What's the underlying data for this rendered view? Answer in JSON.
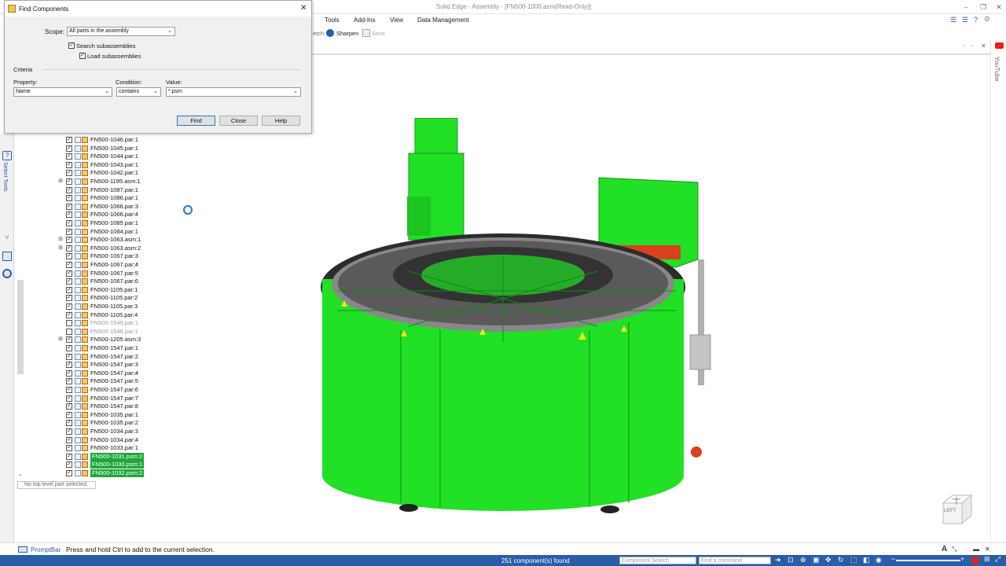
{
  "app": {
    "window_title": "Solid Edge - Assembly - [FN500-1000.asm(Read-Only)]",
    "ribbon_tabs": [
      "Tools",
      "Add-Ins",
      "View",
      "Data Management"
    ],
    "toolbar": {
      "sketch_label": "etch",
      "sharpen_label": "Sharpen",
      "save_label": "Save"
    },
    "youtube_label": "YouTube"
  },
  "dialog": {
    "title": "Find Components",
    "scope_label": "Scope:",
    "scope_value": "All parts in the assembly",
    "search_subassemblies": "Search subassemblies",
    "load_subassemblies": "Load subassemblies",
    "criteria_label": "Criteria",
    "property_label": "Property:",
    "property_value": "Name",
    "condition_label": "Condition:",
    "condition_value": "contains",
    "value_label": "Value:",
    "value_value": "*.psm",
    "find_button": "Find",
    "close_button": "Close",
    "help_button": "Help"
  },
  "left_strip": {
    "select_tools_label": "Select Tools"
  },
  "tree": {
    "items": [
      {
        "label": "FN500-1046.par:1",
        "checked": true,
        "state": "normal",
        "expandable": false
      },
      {
        "label": "FN500-1045.par:1",
        "checked": true,
        "state": "normal",
        "expandable": false
      },
      {
        "label": "FN500-1044.par:1",
        "checked": true,
        "state": "normal",
        "expandable": false
      },
      {
        "label": "FN500-1043.par:1",
        "checked": true,
        "state": "normal",
        "expandable": false
      },
      {
        "label": "FN500-1042.par:1",
        "checked": true,
        "state": "normal",
        "expandable": false
      },
      {
        "label": "FN500-1195.asm:1",
        "checked": true,
        "state": "normal",
        "expandable": true
      },
      {
        "label": "FN500-1087.par:1",
        "checked": true,
        "state": "normal",
        "expandable": false
      },
      {
        "label": "FN500-1086.par:1",
        "checked": true,
        "state": "normal",
        "expandable": false
      },
      {
        "label": "FN500-1066.par:3",
        "checked": true,
        "state": "normal",
        "expandable": false
      },
      {
        "label": "FN500-1066.par:4",
        "checked": true,
        "state": "normal",
        "expandable": false
      },
      {
        "label": "FN500-1085.par:1",
        "checked": true,
        "state": "normal",
        "expandable": false
      },
      {
        "label": "FN500-1084.par:1",
        "checked": true,
        "state": "normal",
        "expandable": false
      },
      {
        "label": "FN500-1063.asm:1",
        "checked": true,
        "state": "normal",
        "expandable": true
      },
      {
        "label": "FN500-1063.asm:2",
        "checked": true,
        "state": "normal",
        "expandable": true
      },
      {
        "label": "FN500-1067.par:3",
        "checked": true,
        "state": "normal",
        "expandable": false
      },
      {
        "label": "FN500-1067.par:4",
        "checked": true,
        "state": "normal",
        "expandable": false
      },
      {
        "label": "FN500-1067.par:5",
        "checked": true,
        "state": "normal",
        "expandable": false
      },
      {
        "label": "FN500-1067.par:6",
        "checked": true,
        "state": "normal",
        "expandable": false
      },
      {
        "label": "FN500-1105.par:1",
        "checked": true,
        "state": "normal",
        "expandable": false
      },
      {
        "label": "FN500-1105.par:2",
        "checked": true,
        "state": "normal",
        "expandable": false
      },
      {
        "label": "FN500-1105.par:3",
        "checked": true,
        "state": "normal",
        "expandable": false
      },
      {
        "label": "FN500-1105.par:4",
        "checked": true,
        "state": "normal",
        "expandable": false
      },
      {
        "label": "FN500-1549.par:1",
        "checked": false,
        "state": "dim",
        "expandable": false
      },
      {
        "label": "FN500-1548.par:1",
        "checked": false,
        "state": "dim",
        "expandable": false
      },
      {
        "label": "FN500-1205.asm:3",
        "checked": true,
        "state": "normal",
        "expandable": true
      },
      {
        "label": "FN500-1547.par:1",
        "checked": true,
        "state": "normal",
        "expandable": false
      },
      {
        "label": "FN500-1547.par:2",
        "checked": true,
        "state": "normal",
        "expandable": false
      },
      {
        "label": "FN500-1547.par:3",
        "checked": true,
        "state": "normal",
        "expandable": false
      },
      {
        "label": "FN500-1547.par:4",
        "checked": true,
        "state": "normal",
        "expandable": false
      },
      {
        "label": "FN500-1547.par:5",
        "checked": true,
        "state": "normal",
        "expandable": false
      },
      {
        "label": "FN500-1547.par:6",
        "checked": true,
        "state": "normal",
        "expandable": false
      },
      {
        "label": "FN500-1547.par:7",
        "checked": true,
        "state": "normal",
        "expandable": false
      },
      {
        "label": "FN500-1547.par:8",
        "checked": true,
        "state": "normal",
        "expandable": false
      },
      {
        "label": "FN500-1035.par:1",
        "checked": true,
        "state": "normal",
        "expandable": false
      },
      {
        "label": "FN500-1035.par:2",
        "checked": true,
        "state": "normal",
        "expandable": false
      },
      {
        "label": "FN500-1034.par:3",
        "checked": true,
        "state": "normal",
        "expandable": false
      },
      {
        "label": "FN500-1034.par:4",
        "checked": true,
        "state": "normal",
        "expandable": false
      },
      {
        "label": "FN500-1033.par:1",
        "checked": true,
        "state": "normal",
        "expandable": false
      },
      {
        "label": "FN500-1031.psm:2",
        "checked": true,
        "state": "selected",
        "expandable": false
      },
      {
        "label": "FN500-1030.psm:1",
        "checked": true,
        "state": "selected",
        "expandable": false
      },
      {
        "label": "FN500-1032.psm:2",
        "checked": true,
        "state": "selected",
        "expandable": false
      }
    ],
    "status": "No top level part selected."
  },
  "prompt_bar": {
    "label": "PromptBar",
    "message": "Press and hold Ctrl to add to the current selection."
  },
  "status_bar": {
    "count": "251 component(s) found",
    "component_search_placeholder": "Component Search",
    "find_command_placeholder": "Find a command"
  },
  "viewcube": {
    "face_label": "LEFT"
  },
  "colors": {
    "selection_green": "#1ea63a",
    "model_green": "#22e026",
    "status_blue": "#2a5da8",
    "accent_blue": "#1e78d8"
  }
}
